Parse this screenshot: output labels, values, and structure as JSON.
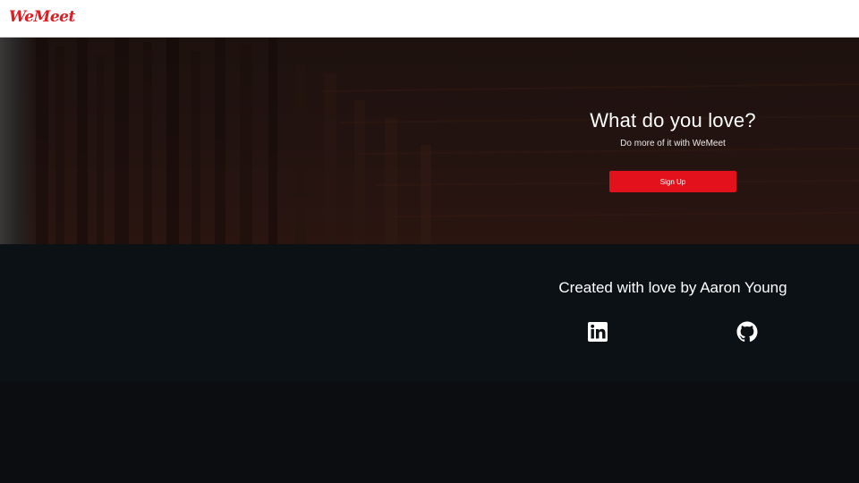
{
  "navbar": {
    "logo_text": "WeMeet",
    "brand_color": "#e11b22"
  },
  "hero": {
    "title": "What do you love?",
    "subtitle": "Do more of it with WeMeet",
    "signup_label": "Sign Up",
    "button_color": "#e3111b"
  },
  "footer": {
    "title": "Created with love by Aaron Young",
    "links": [
      {
        "icon": "linkedin-icon"
      },
      {
        "icon": "github-icon"
      }
    ]
  }
}
